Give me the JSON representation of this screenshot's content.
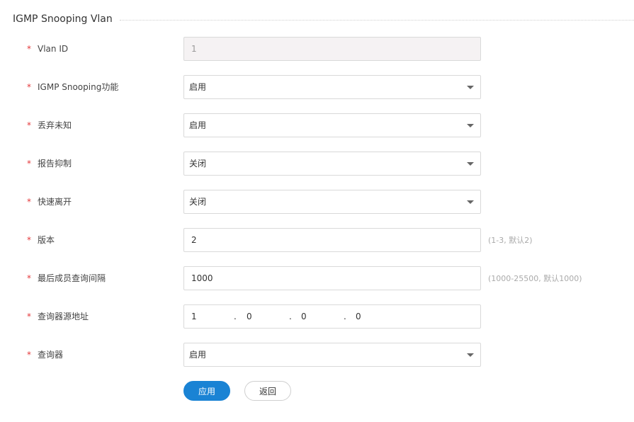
{
  "section": {
    "title": "IGMP Snooping Vlan"
  },
  "form": {
    "required_mark": "*",
    "vlan_id": {
      "label": "Vlan ID",
      "value": "1"
    },
    "igmp_snooping": {
      "label": "IGMP Snooping功能",
      "value": "启用"
    },
    "drop_unknown": {
      "label": "丢弃未知",
      "value": "启用"
    },
    "report_suppress": {
      "label": "报告抑制",
      "value": "关闭"
    },
    "fast_leave": {
      "label": "快速离开",
      "value": "关闭"
    },
    "version": {
      "label": "版本",
      "value": "2",
      "hint": "(1-3, 默认2)"
    },
    "last_member_interval": {
      "label": "最后成员查询间隔",
      "value": "1000",
      "hint": "(1000-25500, 默认1000)"
    },
    "querier_source": {
      "label": "查询器源地址",
      "octets": [
        "1",
        "0",
        "0",
        "0"
      ],
      "separator": "."
    },
    "querier": {
      "label": "查询器",
      "value": "启用"
    }
  },
  "actions": {
    "apply_label": "应用",
    "back_label": "返回"
  },
  "colors": {
    "primary": "#1a83d4",
    "required": "#e4393c"
  }
}
